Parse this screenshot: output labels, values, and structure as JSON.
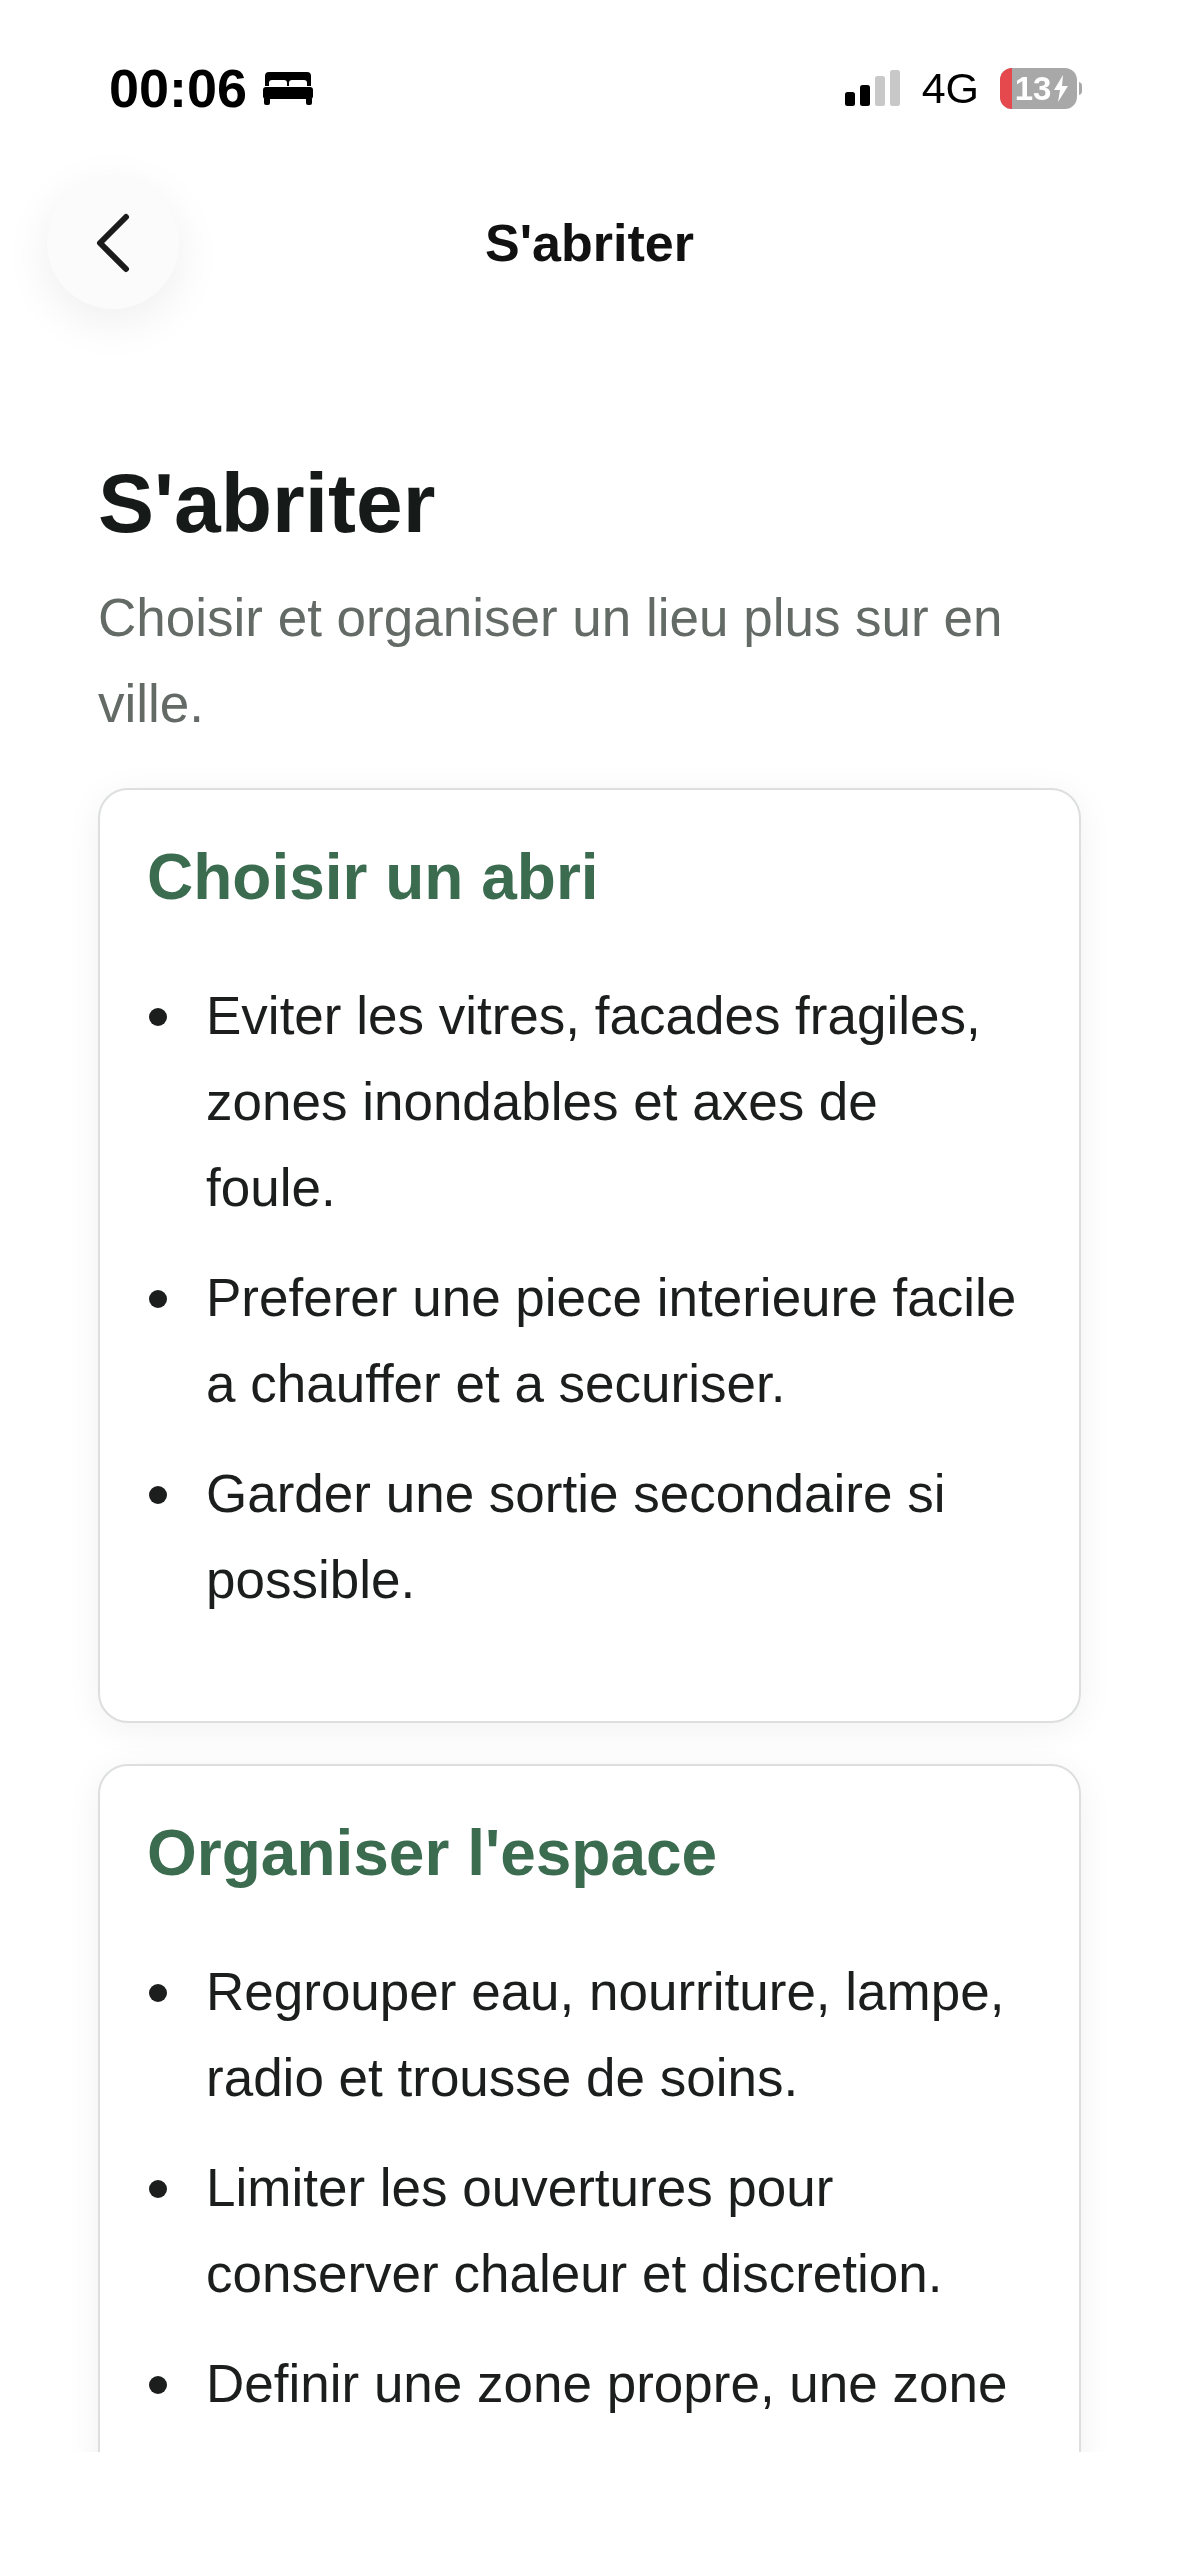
{
  "status_bar": {
    "time": "00:06",
    "network": "4G",
    "battery": "13"
  },
  "nav": {
    "title": "S'abriter"
  },
  "page": {
    "title": "S'abriter",
    "subtitle": "Choisir et organiser un lieu plus sur en ville."
  },
  "sections": [
    {
      "heading": "Choisir un abri",
      "items": [
        "Eviter les vitres, facades fragiles, zones inondables et axes de foule.",
        "Preferer une piece interieure facile a chauffer et a securiser.",
        "Garder une sortie secondaire si possible."
      ]
    },
    {
      "heading": "Organiser l'espace",
      "items": [
        "Regrouper eau, nourriture, lampe, radio et trousse de soins.",
        "Limiter les ouvertures pour conserver chaleur et discretion.",
        "Definir une zone propre, une zone"
      ]
    }
  ]
}
